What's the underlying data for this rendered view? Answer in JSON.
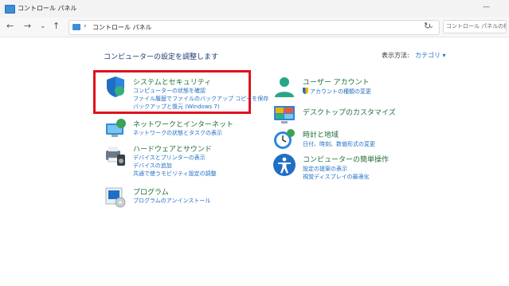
{
  "window": {
    "title": "コントロール パネル"
  },
  "nav": {
    "back_icon": "back-arrow-icon",
    "forward_icon": "forward-arrow-icon",
    "up_icon": "up-arrow-icon",
    "address_sep": "›",
    "address_text": "コントロール パネル",
    "search_placeholder": "コントロール パネルの検索"
  },
  "header": {
    "heading": "コンピューターの設定を調整します",
    "view_by_label": "表示方法:",
    "view_by_value": "カテゴリ ▾"
  },
  "categories_left": [
    {
      "title": "システムとセキュリティ",
      "icon": "shield-icon",
      "links": [
        "コンピューターの状態を確認",
        "ファイル履歴でファイルのバックアップ コピーを保存",
        "バックアップと復元 (Windows 7)"
      ]
    },
    {
      "title": "ネットワークとインターネット",
      "icon": "network-globe-icon",
      "links": [
        "ネットワークの状態とタスクの表示"
      ]
    },
    {
      "title": "ハードウェアとサウンド",
      "icon": "printer-speaker-icon",
      "links": [
        "デバイスとプリンターの表示",
        "デバイスの追加",
        "共通で使うモビリティ設定の調整"
      ]
    },
    {
      "title": "プログラム",
      "icon": "program-disk-icon",
      "links": [
        "プログラムのアンインストール"
      ]
    }
  ],
  "categories_right": [
    {
      "title": "ユーザー アカウント",
      "icon": "user-account-icon",
      "links": [
        "アカウントの種類の変更"
      ]
    },
    {
      "title": "デスクトップのカスタマイズ",
      "icon": "desktop-customize-icon",
      "links": []
    },
    {
      "title": "時計と地域",
      "icon": "clock-globe-icon",
      "links": [
        "日付、時刻、数値形式の変更"
      ]
    },
    {
      "title": "コンピューターの簡単操作",
      "icon": "accessibility-icon",
      "links": [
        "設定の提案の表示",
        "視覚ディスプレイの最適化"
      ]
    }
  ],
  "colors": {
    "highlight": "#e0121d",
    "link": "#1f6fc5",
    "title": "#1f6f3a"
  }
}
